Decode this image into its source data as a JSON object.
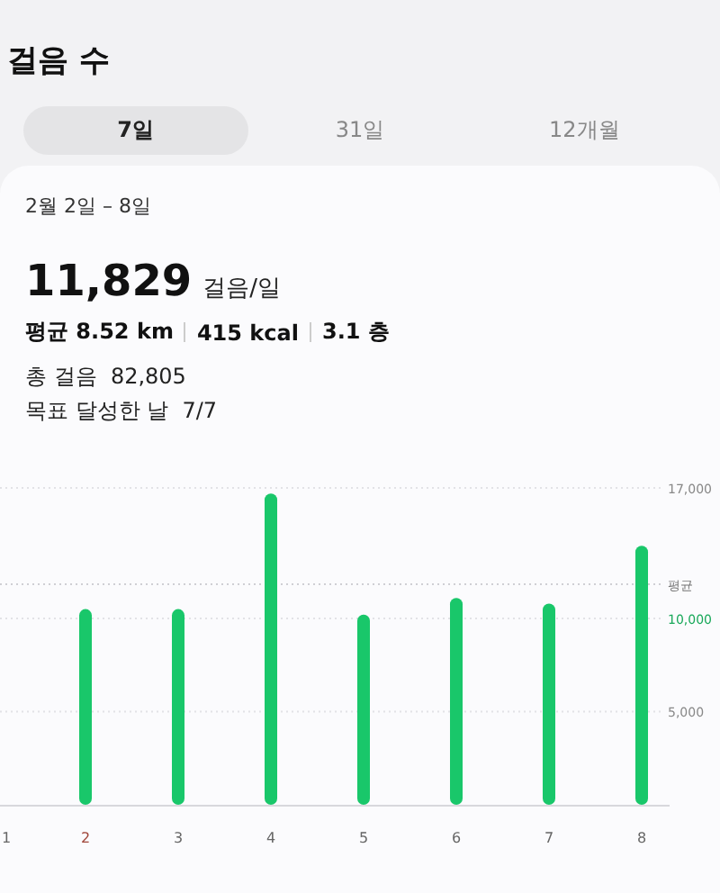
{
  "title": "걸음 수",
  "tabs": [
    {
      "label": "7일",
      "selected": true
    },
    {
      "label": "31일",
      "selected": false
    },
    {
      "label": "12개월",
      "selected": false
    }
  ],
  "range": "2월 2일 – 8일",
  "headline": {
    "value": "11,829",
    "unit": "걸음/일"
  },
  "stats": [
    "평균 8.52 km",
    "415 kcal",
    "3.1 층"
  ],
  "details": [
    {
      "label": "총 걸음",
      "value": "82,805"
    },
    {
      "label": "목표 달성한 날",
      "value": "7/7"
    }
  ],
  "chart": {
    "chart_data": {
      "type": "bar",
      "categories": [
        "1",
        "2",
        "3",
        "4",
        "5",
        "6",
        "7",
        "8"
      ],
      "series": [
        {
          "color": "#19c76a",
          "values": [
            null,
            10500,
            10500,
            16700,
            10200,
            11100,
            10800,
            13900
          ]
        }
      ],
      "ylim": [
        0,
        17000
      ],
      "yticks": [
        {
          "value": 5000,
          "label": "5,000"
        },
        {
          "value": 10000,
          "label": "10,000"
        },
        {
          "value": 17000,
          "label": "17,000"
        }
      ],
      "ref_lines": [
        {
          "axis": "y",
          "value": 11829,
          "label": "평균"
        }
      ]
    },
    "tick_marks": [
      {
        "color": "#888888"
      },
      {
        "color": "#19a85a"
      },
      {
        "color": "#888888"
      }
    ],
    "category_marks": [
      {
        "color": "#666666"
      },
      {
        "color": "#a0463a"
      },
      {
        "color": "#666666"
      },
      {
        "color": "#666666"
      },
      {
        "color": "#666666"
      },
      {
        "color": "#666666"
      },
      {
        "color": "#666666"
      },
      {
        "color": "#666666"
      }
    ]
  }
}
